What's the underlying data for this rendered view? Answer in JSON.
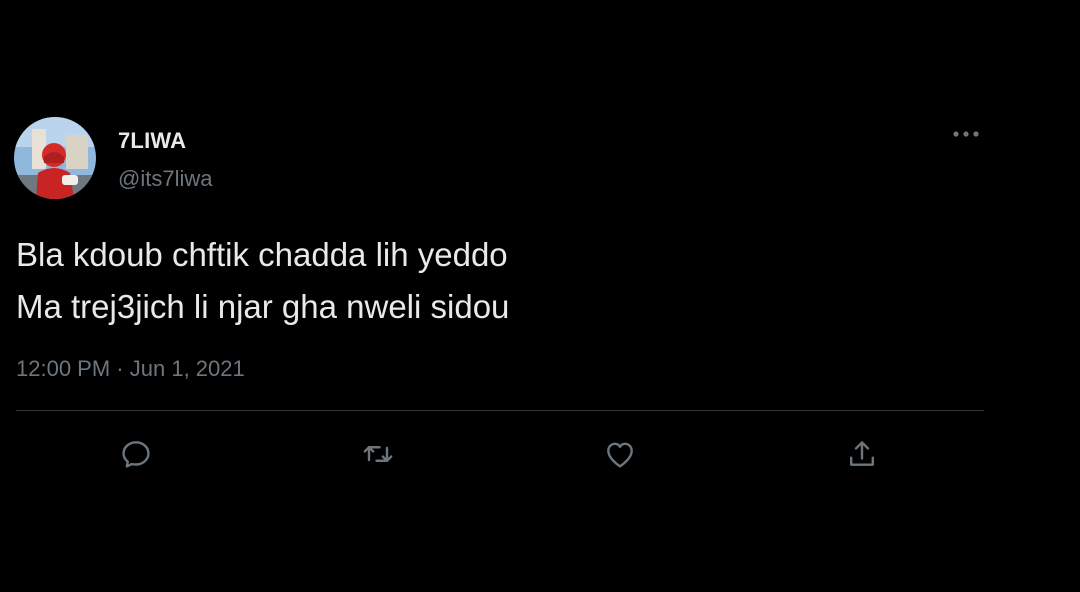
{
  "tweet": {
    "display_name": "7LIWA",
    "handle": "@its7liwa",
    "text_lines": [
      "Bla kdoub chftik chadda lih yeddo",
      "Ma trej3jich li njar gha nweli sidou"
    ],
    "time": "12:00 PM",
    "separator": "·",
    "date": "Jun 1, 2021"
  },
  "icons": {
    "avatar": "avatar-image",
    "more": "more-horizontal-icon",
    "reply": "reply-icon",
    "retweet": "retweet-icon",
    "like": "heart-icon",
    "share": "share-icon"
  },
  "colors": {
    "background": "#000000",
    "text": "#e7e9ea",
    "secondary": "#6e767d",
    "divider": "#2f3336"
  }
}
